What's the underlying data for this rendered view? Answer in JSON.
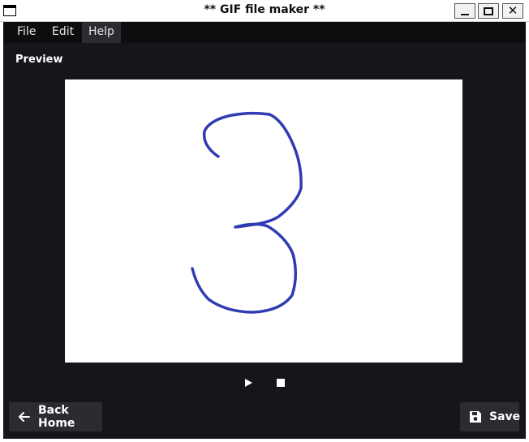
{
  "window": {
    "title": "** GIF file maker **"
  },
  "menu": {
    "file": "File",
    "edit": "Edit",
    "help": "Help"
  },
  "preview": {
    "label": "Preview",
    "drawing_color": "#2f3bb0"
  },
  "player": {
    "play_icon": "play-icon",
    "stop_icon": "stop-icon"
  },
  "buttons": {
    "back_home": "Back Home",
    "save": "Save"
  },
  "colors": {
    "window_bg": "#15151a",
    "menubar_bg": "#0d0d10",
    "button_bg": "#2b2c32"
  }
}
